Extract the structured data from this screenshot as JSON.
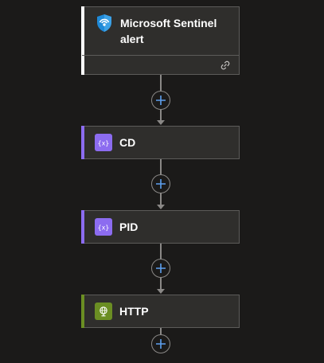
{
  "trigger": {
    "title": "Microsoft Sentinel alert",
    "icon": "sentinel-shield-icon",
    "accent": "#ffffff",
    "footer_icon": "link-icon"
  },
  "steps": [
    {
      "label": "CD",
      "icon": "variable-icon",
      "accent": "#8c6cf0",
      "icon_bg": "#8c6cf0"
    },
    {
      "label": "PID",
      "icon": "variable-icon",
      "accent": "#8c6cf0",
      "icon_bg": "#8c6cf0"
    },
    {
      "label": "HTTP",
      "icon": "globe-icon",
      "accent": "#6b8e23",
      "icon_bg": "#6b8e23"
    }
  ],
  "add_button": {
    "icon": "plus-icon",
    "color": "#5ea0ef"
  },
  "colors": {
    "background": "#1b1a19",
    "card": "#2f2e2c",
    "border": "#5c5b59",
    "connector": "#8a8886"
  }
}
